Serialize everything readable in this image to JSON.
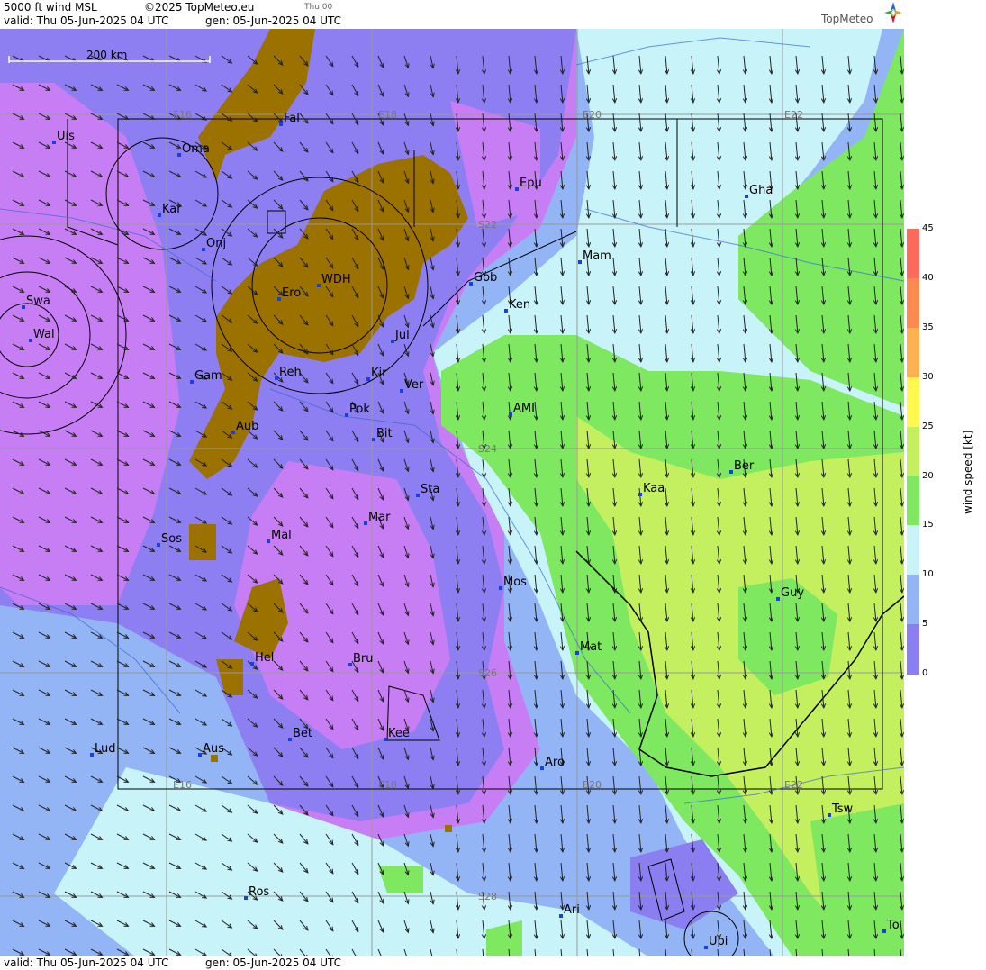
{
  "header": {
    "title": "5000 ft wind MSL",
    "copyright": "©2025 TopMeteo.eu",
    "short_time": "Thu 00",
    "valid": "valid:  Thu  05-Jun-2025  04 UTC",
    "gen": "gen: 05-Jun-2025 04 UTC",
    "logo": "TopMeteo"
  },
  "footer": {
    "valid": "valid:  Thu  05-Jun-2025  04 UTC",
    "gen": "gen: 05-Jun-2025 04 UTC"
  },
  "scale_bar": "200 km",
  "legend": {
    "title": "wind speed [kt]",
    "ticks": [
      "45",
      "40",
      "35",
      "30",
      "25",
      "20",
      "15",
      "10",
      "5",
      "0"
    ],
    "colors": {
      "c0": "#c77ef5",
      "c5": "#8a7ef0",
      "c10": "#93b4f5",
      "c15": "#c8f3f8",
      "c20": "#7ee860",
      "c25": "#c4f060",
      "c30": "#fff84f",
      "c35": "#ffb050",
      "c40": "#ff8a50",
      "c45": "#ff6a5a"
    },
    "terrain": "#9b7100"
  },
  "grid_labels": [
    "E16",
    "E18",
    "E20",
    "E22",
    "S22",
    "S24",
    "S26",
    "S28",
    "E16",
    "E18",
    "E20",
    "E22"
  ],
  "cities": [
    "Uis",
    "Oma",
    "Fal",
    "Kar",
    "Onj",
    "Swa",
    "Wal",
    "Ero",
    "WDH",
    "Epu",
    "Gha",
    "Mam",
    "Gob",
    "Ken",
    "Jul",
    "Gam",
    "Reh",
    "Kir",
    "Ver",
    "AMI",
    "Pok",
    "Bit",
    "Aub",
    "Ber",
    "Kaa",
    "Sta",
    "Mar",
    "Sos",
    "Mal",
    "Mos",
    "Guy",
    "Mat",
    "Hel",
    "Bru",
    "Bet",
    "Kee",
    "Lud",
    "Aus",
    "Aro",
    "Tsw",
    "Ros",
    "Ari",
    "Upi",
    "To"
  ]
}
